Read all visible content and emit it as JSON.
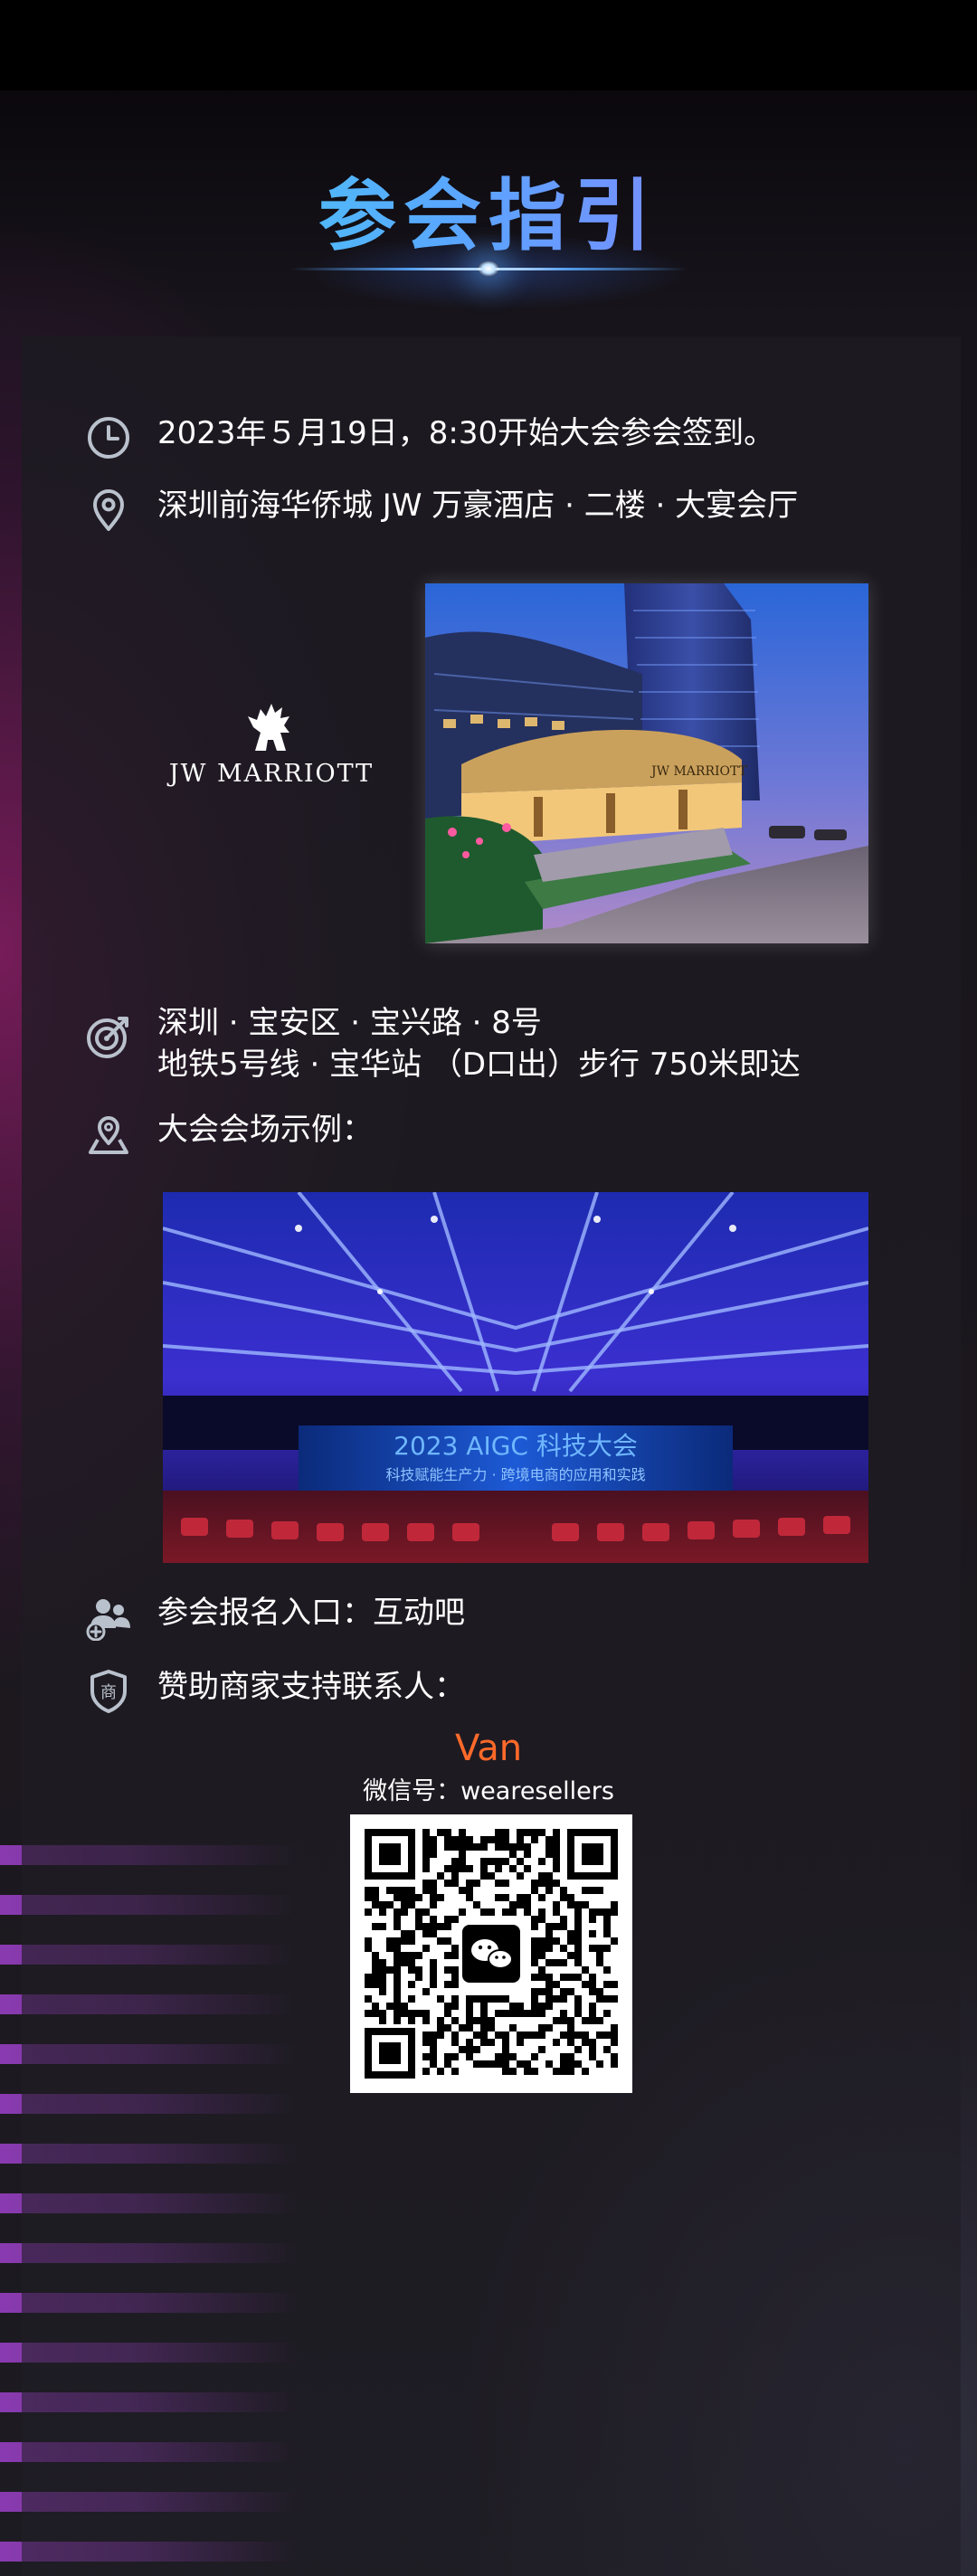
{
  "header": {
    "title": "参会指引"
  },
  "info": {
    "time": "2023年５月19日，8:30开始大会参会签到。",
    "venue": "深圳前海华侨城 JW 万豪酒店 · 二楼 · 大宴会厅",
    "address_line1": "深圳 · 宝安区 · 宝兴路 · 8号",
    "address_line2": "地铁5号线 · 宝华站 （D口出）步行 750米即达",
    "venue_example": "大会会场示例：",
    "registration": "参会报名入口：互动吧",
    "sponsor_contact": "赞助商家支持联系人："
  },
  "hotel": {
    "logo_text": "JW MARRIOTT",
    "sign_text": "JW MARRIOTT"
  },
  "venue_banner": {
    "title": "2023 AIGC 科技大会",
    "subtitle": "科技赋能生产力 · 跨境电商的应用和实践"
  },
  "contact": {
    "name": "Van",
    "wechat": "微信号：wearesellers"
  },
  "colors": {
    "accent_orange": "#ff6a2a",
    "title_gradient_start": "#3fe0e6",
    "title_gradient_end": "#9f6cff",
    "icon_gray": "#b9c1cc",
    "stripe_purple": "#af46e1"
  },
  "icons": {
    "time": "clock-icon",
    "venue": "location-pin-icon",
    "address": "target-icon",
    "venue_example": "map-pin-icon",
    "registration": "users-add-icon",
    "sponsor": "shop-shield-icon",
    "qr_center": "wechat-icon"
  }
}
